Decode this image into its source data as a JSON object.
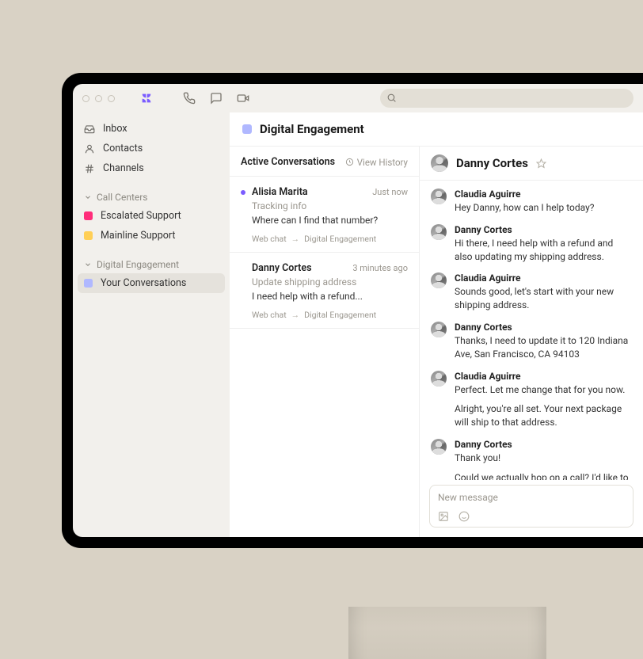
{
  "sidebar": {
    "nav": [
      {
        "label": "Inbox"
      },
      {
        "label": "Contacts"
      },
      {
        "label": "Channels"
      }
    ],
    "sections": [
      {
        "title": "Call Centers",
        "items": [
          {
            "label": "Escalated Support",
            "color": "#ff2d7a"
          },
          {
            "label": "Mainline Support",
            "color": "#ffcf56"
          }
        ]
      },
      {
        "title": "Digital Engagement",
        "items": [
          {
            "label": "Your Conversations",
            "color": "#b0b8ff",
            "active": true
          }
        ]
      }
    ]
  },
  "main": {
    "title": "Digital Engagement"
  },
  "conversations": {
    "header": "Active Conversations",
    "view_history": "View History",
    "items": [
      {
        "unread": true,
        "name": "Alisia Marita",
        "time": "Just now",
        "subject": "Tracking info",
        "preview": "Where can I find that number?",
        "source": "Web chat",
        "dest": "Digital Engagement"
      },
      {
        "unread": false,
        "name": "Danny Cortes",
        "time": "3 minutes ago",
        "subject": "Update shipping address",
        "preview": "I need help with a refund...",
        "source": "Web chat",
        "dest": "Digital Engagement"
      }
    ]
  },
  "thread": {
    "name": "Danny Cortes",
    "messages": [
      {
        "author": "Claudia Aguirre",
        "lines": [
          "Hey Danny, how can I help today?"
        ]
      },
      {
        "author": "Danny Cortes",
        "lines": [
          "Hi there, I need help with a refund and also updating my shipping address."
        ]
      },
      {
        "author": "Claudia Aguirre",
        "lines": [
          "Sounds good, let's start with your new shipping address."
        ]
      },
      {
        "author": "Danny Cortes",
        "lines": [
          "Thanks, I need to update it to 120 Indiana Ave, San Francisco, CA 94103"
        ]
      },
      {
        "author": "Claudia Aguirre",
        "lines": [
          "Perfect. Let me change that for you now.",
          "Alright, you're all set. Your next package will ship to that address."
        ]
      },
      {
        "author": "Danny Cortes",
        "lines": [
          "Thank you!",
          "Could we actually hop on a call? I'd like to get more details to add expedited shipping to the order up above."
        ]
      }
    ]
  },
  "composer": {
    "placeholder": "New message"
  },
  "search": {
    "placeholder": ""
  }
}
